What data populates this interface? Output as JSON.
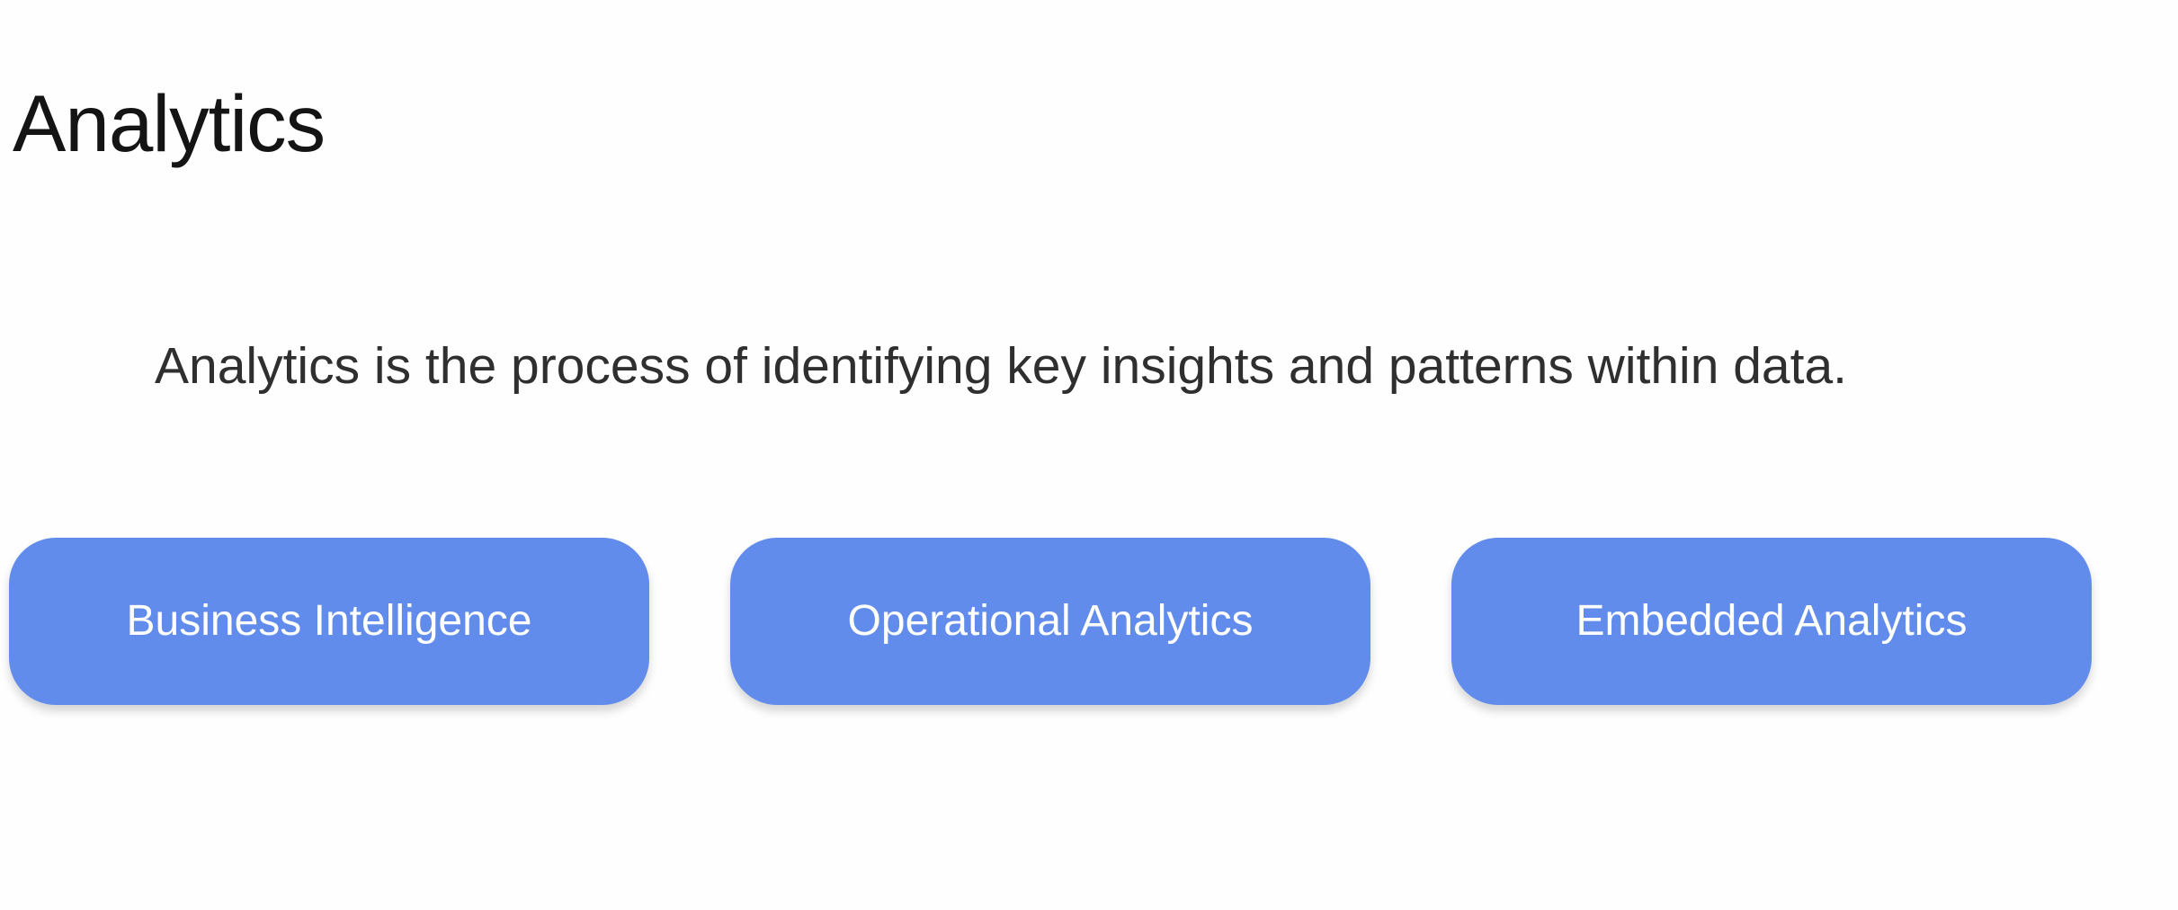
{
  "slide": {
    "title": "Analytics",
    "definition": "Analytics is the process of identifying key insights and patterns within data.",
    "categories": [
      {
        "label": "Business Intelligence"
      },
      {
        "label": "Operational Analytics"
      },
      {
        "label": "Embedded Analytics"
      }
    ]
  },
  "colors": {
    "background": "#fefefe",
    "title_text": "#141414",
    "body_text": "#2f2f2f",
    "card_fill": "#628cec",
    "card_text": "#ffffff"
  }
}
